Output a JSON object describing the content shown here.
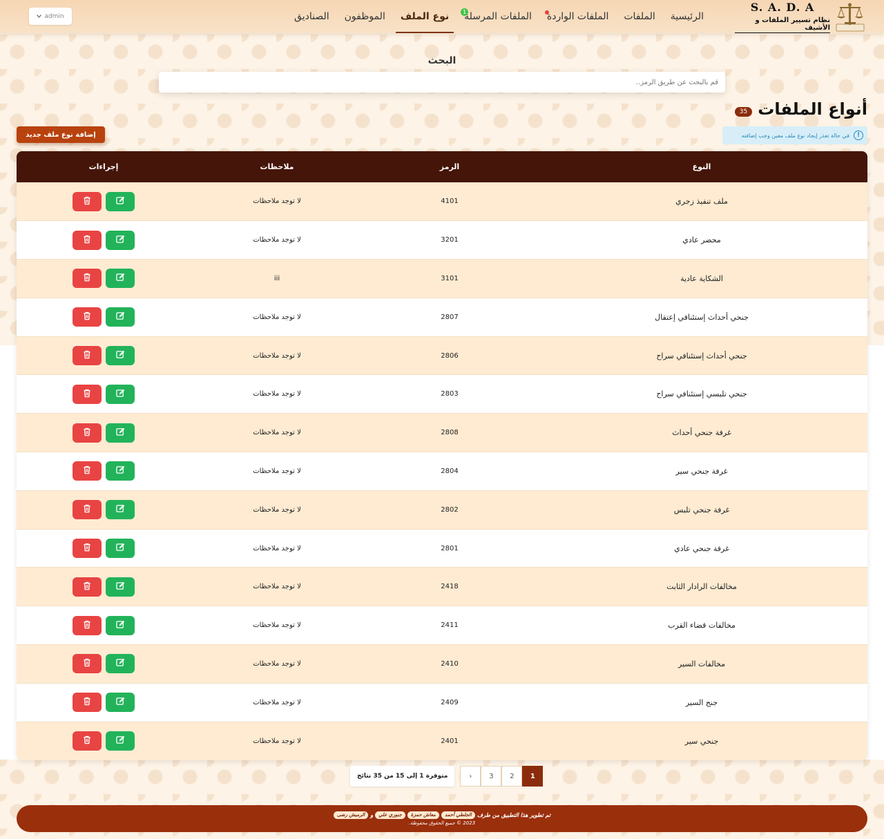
{
  "brand": {
    "name": "S. A. D. A",
    "subtitle": "نظام تسيير الملفات و الأشيف"
  },
  "nav": {
    "items": [
      {
        "label": "الرئيسية",
        "name": "nav-home"
      },
      {
        "label": "الملفات",
        "name": "nav-files"
      },
      {
        "label": "الملفات الواردة",
        "name": "nav-incoming"
      },
      {
        "label": "الملفات المرسلة",
        "name": "nav-sent"
      },
      {
        "label": "نوع الملف",
        "name": "nav-file-type"
      },
      {
        "label": "الموظفون",
        "name": "nav-employees"
      },
      {
        "label": "الصناديق",
        "name": "nav-boxes"
      }
    ],
    "sent_badge": "1",
    "admin_label": "admin"
  },
  "search": {
    "title": "البحث",
    "placeholder": "قم بالبحث عن طريق الرمز.."
  },
  "header": {
    "title": "أنواع الملفات",
    "count": "35",
    "info": "في حالة تعذر إيجاد نوع ملف معين وجب إضافته",
    "add_button": "إضافة نوع ملف جديد"
  },
  "table": {
    "columns": [
      "النوع",
      "الرمز",
      "ملاحظات",
      "إجراءات"
    ],
    "rows": [
      {
        "type": "ملف تنفيذ زجري",
        "code": "4101",
        "notes": "لا توجد ملاحظات"
      },
      {
        "type": "محضر عادي",
        "code": "3201",
        "notes": "لا توجد ملاحظات"
      },
      {
        "type": "الشكاية عادية",
        "code": "3101",
        "notes": "iii"
      },
      {
        "type": "جنحي أحداث إستئنافي إعتقال",
        "code": "2807",
        "notes": "لا توجد ملاحظات"
      },
      {
        "type": "جنحي أحداث إستئنافي سراح",
        "code": "2806",
        "notes": "لا توجد ملاحظات"
      },
      {
        "type": "جنحي تلبسي إستئنافي سراح",
        "code": "2803",
        "notes": "لا توجد ملاحظات"
      },
      {
        "type": "غرفة جنحي أحداث",
        "code": "2808",
        "notes": "لا توجد ملاحظات"
      },
      {
        "type": "غرفة جنحي سير",
        "code": "2804",
        "notes": "لا توجد ملاحظات"
      },
      {
        "type": "غرفة جنحي تلبس",
        "code": "2802",
        "notes": "لا توجد ملاحظات"
      },
      {
        "type": "غرفة جنحي عادي",
        "code": "2801",
        "notes": "لا توجد ملاحظات"
      },
      {
        "type": "مخالفات الرادار الثابت",
        "code": "2418",
        "notes": "لا توجد ملاحظات"
      },
      {
        "type": "مخالفات قضاء القرب",
        "code": "2411",
        "notes": "لا توجد ملاحظات"
      },
      {
        "type": "مخالفات السير",
        "code": "2410",
        "notes": "لا توجد ملاحظات"
      },
      {
        "type": "جنح السير",
        "code": "2409",
        "notes": "لا توجد ملاحظات"
      },
      {
        "type": "جنحي سير",
        "code": "2401",
        "notes": "لا توجد ملاحظات"
      }
    ]
  },
  "pagination": {
    "summary": "متوفرة 1 إلى 15 من 35 نتائج",
    "pages": [
      "1",
      "2",
      "3"
    ],
    "current": "1",
    "next_symbol": "›"
  },
  "footer": {
    "line1_prefix": "تم تطوير هذا التطبيق من طرف",
    "developers": [
      "الجلطي أحمد",
      "معاش حمزة",
      "جبوري علي",
      "الرميش رضى"
    ],
    "connector": "و",
    "line2": "2023 © جميع الحقوق محفوظة."
  },
  "colors": {
    "header_bg": "#441508",
    "accent": "#8b2d0c",
    "edit": "#22b35a",
    "delete": "#e84443",
    "row_odd": "#feebd2"
  }
}
